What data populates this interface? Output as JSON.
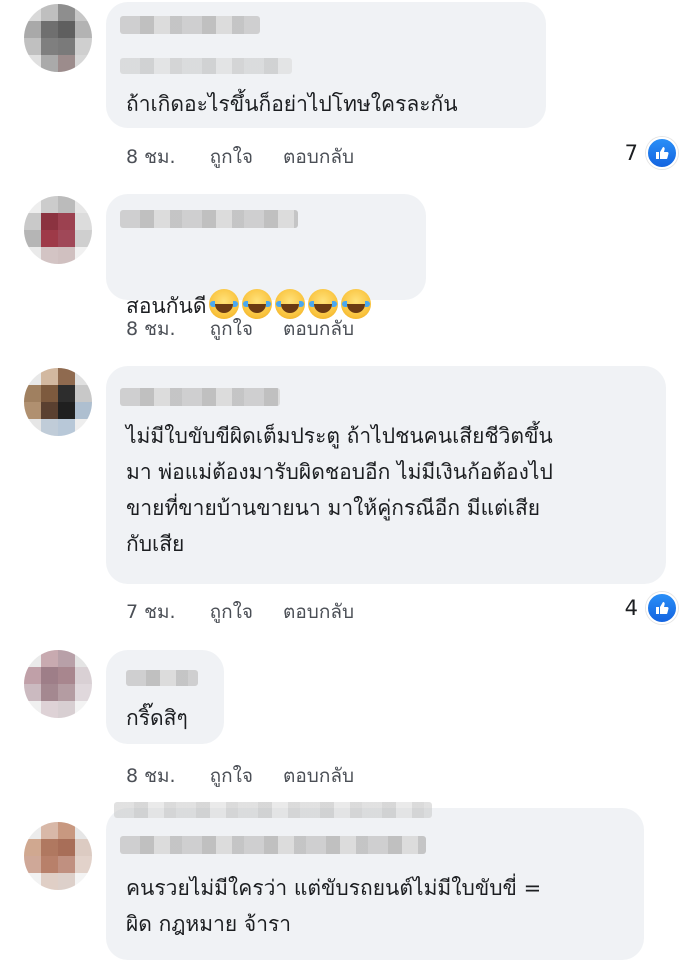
{
  "comments": [
    {
      "text": "ถ้าเกิดอะไรขึ้นก็อย่าไปโทษใครละกัน",
      "time": "8 ชม.",
      "like_label": "ถูกใจ",
      "reply_label": "ตอบกลับ",
      "reaction_count": "7",
      "reaction_icon": "like-icon",
      "avatar_colors": [
        "#d9d9d9",
        "#bfbfbf",
        "#8e8e8e",
        "#c7c7c7",
        "#a9a9a9",
        "#6f6f6f",
        "#5f5f5f",
        "#b3b3b3",
        "#c0c0c0",
        "#7f7f7f",
        "#7a7a7a",
        "#cfcfcf",
        "#e0e0e0",
        "#aaaaaa",
        "#9c8c8c",
        "#d7d7d7"
      ]
    },
    {
      "text": "สอนกันดี",
      "emoji_names": [
        "face-with-tears-of-joy",
        "face-with-tears-of-joy",
        "face-with-tears-of-joy",
        "face-with-tears-of-joy",
        "face-with-tears-of-joy"
      ],
      "time": "8 ชม.",
      "like_label": "ถูกใจ",
      "reply_label": "ตอบกลับ",
      "avatar_colors": [
        "#eeeeee",
        "#cccccc",
        "#bbbbbb",
        "#e6e6e6",
        "#c9c9c9",
        "#8b3340",
        "#9c4150",
        "#dcdcdc",
        "#b5b5b5",
        "#9e3a48",
        "#a04858",
        "#cfcfcf",
        "#eaeaea",
        "#d3c4c4",
        "#d0c0c0",
        "#f1f1f1"
      ]
    },
    {
      "text": "ไม่มีใบขับขีผิดเต็มประตู ถ้าไปชนคนเสียชีวิตขึ้น\nมา พ่อแม่ต้องมารับผิดชอบอีก ไม่มีเงินก้อต้องไป\nขายที่ขายบ้านขายนา มาให้คู่กรณีอีก มีแต่เสีย\nกับเสีย",
      "time": "7 ชม.",
      "like_label": "ถูกใจ",
      "reply_label": "ตอบกลับ",
      "reaction_count": "4",
      "reaction_icon": "like-icon",
      "avatar_colors": [
        "#e8e8e8",
        "#d2b8a0",
        "#8f6a4f",
        "#e0e0e0",
        "#a08060",
        "#7d5a3e",
        "#2d2d2d",
        "#c8c8c8",
        "#b09070",
        "#5a4030",
        "#1f1f1f",
        "#aebfd0",
        "#e6e6e6",
        "#c0ccd8",
        "#b8c8d8",
        "#eeeeee"
      ]
    },
    {
      "text": "กริ๊ดสิๆ",
      "time": "8 ชม.",
      "like_label": "ถูกใจ",
      "reply_label": "ตอบกลับ",
      "avatar_colors": [
        "#eaeaea",
        "#c8aab0",
        "#b8a0a8",
        "#e4e4e4",
        "#c0a0a8",
        "#9e7e88",
        "#a8868e",
        "#d9d0d4",
        "#cbbac0",
        "#a48890",
        "#b49ca2",
        "#e0d8dc",
        "#f0f0f0",
        "#ded2d6",
        "#d8cfd2",
        "#f3f3f3"
      ]
    },
    {
      "text": "คนรวยไม่มีใครว่า แต่ขับรถยนต์ไม่มีใบขับขี่ =\nผิด กฎหมาย จ้ารา",
      "avatar_colors": [
        "#ececec",
        "#d8b8a8",
        "#c89880",
        "#e6e6e6",
        "#d0a890",
        "#b07860",
        "#a86e58",
        "#dccbc2",
        "#cfa898",
        "#b8806a",
        "#c09080",
        "#e2d2ca",
        "#f2f2f2",
        "#e0cfc6",
        "#ddd0ca",
        "#f4f4f4"
      ]
    }
  ]
}
